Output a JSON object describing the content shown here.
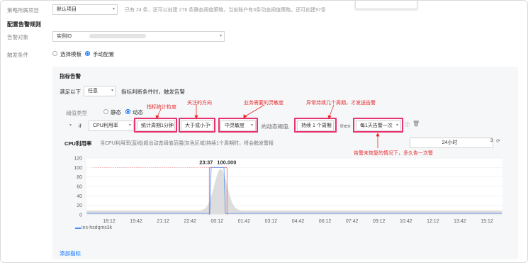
{
  "policy_project": {
    "label": "策略所属项目",
    "value": "默认项目",
    "note": "已有 24 条，还可以创建 276 条静态阈值策略，当前账户有3条动态阈值策略，还可创建97条"
  },
  "alarm_rules_title": "配置告警规则",
  "alarm_object": {
    "label": "告警对象",
    "type_value": "实例ID"
  },
  "trigger": {
    "label": "触发条件",
    "options": [
      "选择模板",
      "手动配置"
    ],
    "selected": "手动配置"
  },
  "metric_alarm": {
    "title": "指标告警",
    "satisfy_prefix": "满足以下",
    "satisfy_select": "任意",
    "satisfy_suffix": "指标判断条件时，触发告警",
    "threshold_type_label": "阈值类型",
    "threshold_options": [
      "静态",
      "动态"
    ],
    "threshold_selected": "动态",
    "if_label": "if",
    "metric_select": "CPU利用率",
    "period_select": "统计周期1分钟",
    "compare_select": "大于或小于",
    "sensitivity_select": "中灵敏度",
    "dynamic_text": "的动态阈值,",
    "duration_select": "持续 1 个周期",
    "then_label": "then",
    "repeat_select": "每1天告警一次"
  },
  "annotations": {
    "period": "指标统计粒度",
    "direction": "关注的方向",
    "sensitivity": "业务需要的灵敏度",
    "duration": "异常持续几个周期，才发送告警",
    "repeat": "告警未恢复的情况下，多久告一次警"
  },
  "chart_header": {
    "title": "CPU利用率",
    "description": "当CPU利用率(蓝线)超出动态阈值范围(灰色区域)持续1个周期时，将会触发警报",
    "range_value": "24小时",
    "range_num": "3"
  },
  "chart_data": {
    "type": "area",
    "x_ticks": [
      "18:12",
      "19:42",
      "21:12",
      "22:42",
      "00:12",
      "01:42",
      "03:12",
      "04:42",
      "06:12",
      "07:42",
      "09:12",
      "10:42",
      "12:12",
      "13:42",
      "15:12"
    ],
    "y_ticks": [
      0,
      20,
      40,
      60,
      80,
      100,
      120
    ],
    "ylim": [
      0,
      120
    ],
    "peak_label_time": "23:37",
    "peak_label_value": "100.000",
    "series": [
      {
        "name": "ins-hsdqms3k",
        "color": "#4a8bf5"
      }
    ],
    "threshold_band_color": "#d9d9d9",
    "marker_color": "#f25c5c"
  },
  "add_metric_link": "添加指标",
  "colors": {
    "accent": "#006eff",
    "annotation": "#e52a2a",
    "highlight_box": "#e8336f"
  }
}
